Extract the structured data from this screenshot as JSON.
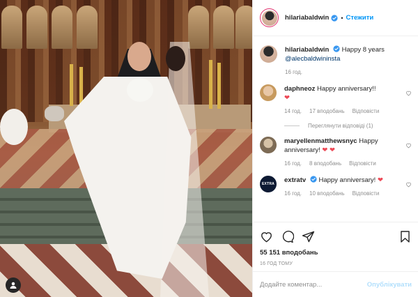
{
  "header": {
    "username": "hilariabaldwin",
    "separator": "•",
    "follow_label": "Стежити"
  },
  "caption": {
    "username": "hilariabaldwin",
    "text": "Happy 8 years",
    "mention": "@alecbaldwininsta",
    "time": "16 год."
  },
  "comments": [
    {
      "username": "daphneoz",
      "text": "Happy anniversary!!",
      "emoji": "❤",
      "time": "14 год.",
      "likes": "17 вподобань",
      "reply": "Відповісти",
      "view_replies": "Переглянути відповіді (1)"
    },
    {
      "username": "maryellenmatthewsnyc",
      "text": "Happy anniversary!",
      "emoji": "❤ ❤",
      "time": "16 год.",
      "likes": "8 вподобань",
      "reply": "Відповісти"
    },
    {
      "username": "extratv",
      "text": "Happy anniversary!",
      "emoji": "❤",
      "time": "16 год.",
      "likes": "10 вподобань",
      "reply": "Відповісти",
      "avatar_text": "EXTRA"
    }
  ],
  "actions": {
    "likes": "55 151 вподобань",
    "timestamp": "16 ГОД ТОМУ"
  },
  "composer": {
    "placeholder": "Додайте коментар...",
    "post_label": "Опублікувати"
  },
  "colors": {
    "accent": "#0095f6",
    "heart": "#ed4956",
    "muted": "#8e8e8e",
    "post_disabled": "#b2dffc"
  },
  "icons": [
    "user-tag-icon",
    "verified-badge-icon",
    "comment-like-icon",
    "like-icon",
    "comment-icon",
    "share-icon",
    "save-icon"
  ]
}
